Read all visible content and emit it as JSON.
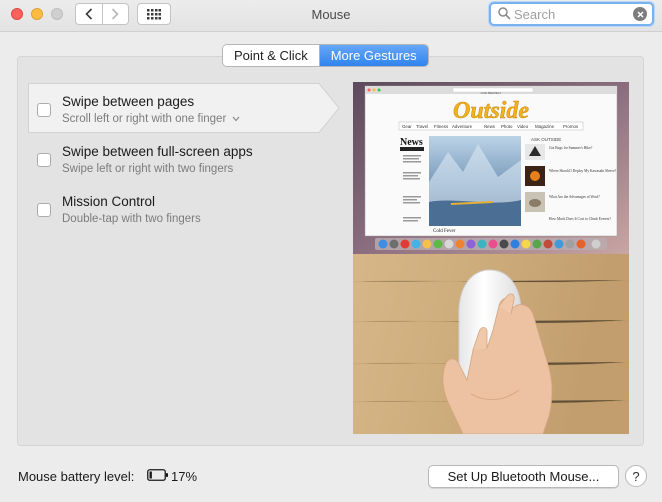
{
  "window": {
    "title": "Mouse"
  },
  "search": {
    "placeholder": "Search",
    "value": ""
  },
  "tabs": [
    {
      "label": "Point & Click",
      "selected": false
    },
    {
      "label": "More Gestures",
      "selected": true
    }
  ],
  "gestures": [
    {
      "title": "Swipe between pages",
      "subtitle": "Scroll left or right with one finger",
      "checked": false,
      "selected": true,
      "has_dropdown": true
    },
    {
      "title": "Swipe between full-screen apps",
      "subtitle": "Swipe left or right with two fingers",
      "checked": false,
      "selected": false,
      "has_dropdown": false
    },
    {
      "title": "Mission Control",
      "subtitle": "Double-tap with two fingers",
      "checked": false,
      "selected": false,
      "has_dropdown": false
    }
  ],
  "preview": {
    "brand": "Outside",
    "brand_tagline": "LIVE BRAVELY",
    "nav": [
      "Gear",
      "Travel",
      "Fitness",
      "Adventure",
      "News",
      "Photo",
      "Video",
      "Magazine",
      "Promos"
    ],
    "news_title": "News",
    "caption": "Cold Fever",
    "sidebar_head": "ASK OUTSIDE",
    "sidebar_items": [
      "Got Bugs for Summer's Hike?",
      "Where Should I Deploy My Kawasaki Sleeve?",
      "How Much Does It Cost to Climb Everest?"
    ],
    "thumb_items": [
      "What Are the Advantages of Wool?"
    ]
  },
  "footer": {
    "battery_label": "Mouse battery level:",
    "battery_value": "17%",
    "battery_level": 0.17,
    "setup_button": "Set Up Bluetooth Mouse...",
    "help": "?"
  },
  "colors": {
    "accent": "#2f84f0",
    "close": "#fc615d",
    "minimize": "#fdbc40"
  }
}
